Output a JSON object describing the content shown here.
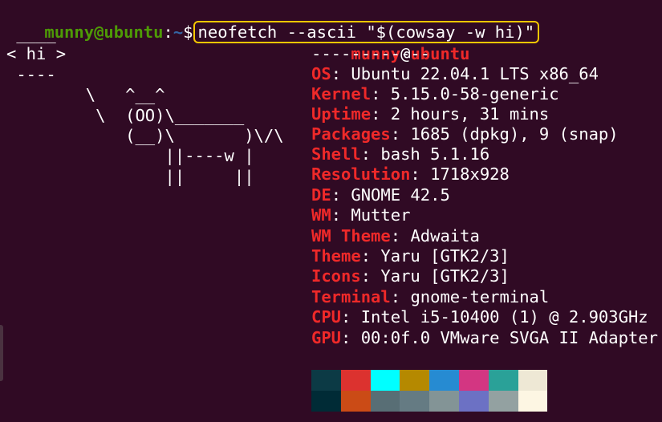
{
  "prompt": {
    "user_host": "munny@ubuntu",
    "separator": ":",
    "path": "~",
    "dollar": "$",
    "command": "neofetch --ascii \"$(cowsay -w hi)\""
  },
  "ascii_art": " ____\n< hi >\n ----\n        \\   ^__^\n         \\  (OO)\\_______\n            (__)\\       )\\/\\\n                ||----w |\n                ||     ||",
  "header": {
    "user": "munny",
    "at": "@",
    "host": "ubuntu",
    "divider": "------------"
  },
  "info": [
    {
      "label": "OS",
      "value": "Ubuntu 22.04.1 LTS x86_64"
    },
    {
      "label": "Kernel",
      "value": "5.15.0-58-generic"
    },
    {
      "label": "Uptime",
      "value": "2 hours, 31 mins"
    },
    {
      "label": "Packages",
      "value": "1685 (dpkg), 9 (snap)"
    },
    {
      "label": "Shell",
      "value": "bash 5.1.16"
    },
    {
      "label": "Resolution",
      "value": "1718x928"
    },
    {
      "label": "DE",
      "value": "GNOME 42.5"
    },
    {
      "label": "WM",
      "value": "Mutter"
    },
    {
      "label": "WM Theme",
      "value": "Adwaita"
    },
    {
      "label": "Theme",
      "value": "Yaru [GTK2/3]"
    },
    {
      "label": "Icons",
      "value": "Yaru [GTK2/3]"
    },
    {
      "label": "Terminal",
      "value": "gnome-terminal"
    },
    {
      "label": "CPU",
      "value": "Intel i5-10400 (1) @ 2.903GHz"
    },
    {
      "label": "GPU",
      "value": "00:0f.0 VMware SVGA II Adapter"
    }
  ],
  "colors": {
    "background": "#300a24",
    "prompt_user": "#4e9a06",
    "prompt_path": "#3465a4",
    "label": "#ef2929",
    "highlight_box": "#f6c700"
  },
  "palette_rows": [
    [
      "#0c3a45",
      "#dc322f",
      "#00ffff",
      "#b58900",
      "#268bd2",
      "#d33682",
      "#2aa198",
      "#eee8d5"
    ],
    [
      "#002b36",
      "#cb4b16",
      "#586e75",
      "#657b83",
      "#839496",
      "#6c71c4",
      "#93a1a1",
      "#fdf6e3"
    ]
  ]
}
